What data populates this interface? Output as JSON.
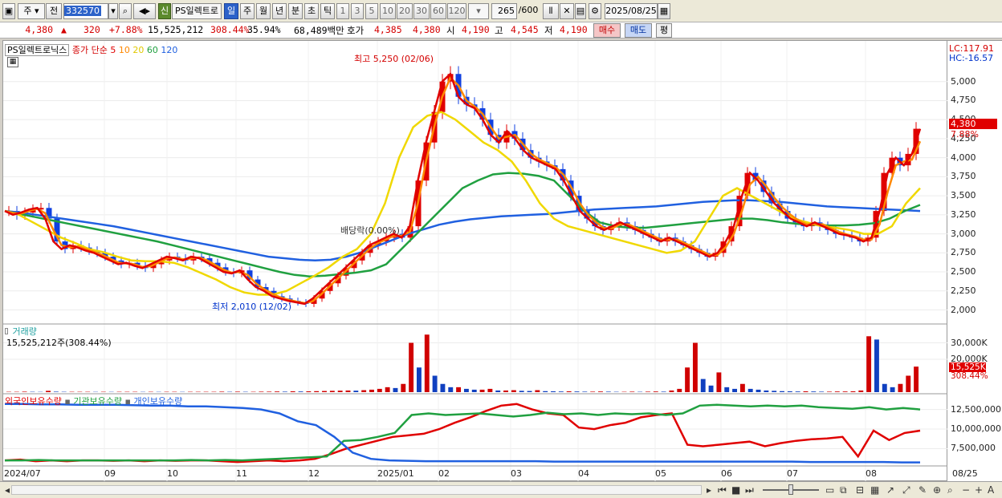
{
  "toolbar": {
    "market_type": "주",
    "prev": "전",
    "code": "332570",
    "new_badge": "신",
    "stock_name": "PS일렉트로",
    "periods": [
      "일",
      "주",
      "월",
      "년",
      "분",
      "초",
      "틱"
    ],
    "active_period": "일",
    "minutes": [
      "1",
      "3",
      "5",
      "10",
      "20",
      "30",
      "60",
      "120"
    ],
    "count": "265",
    "count_max": "/600",
    "date": "2025/08/25"
  },
  "quote": {
    "price": "4,380",
    "change_arrow": "▲",
    "change": "320",
    "change_pct": "+7.88%",
    "volume": "15,525,212",
    "volume_pct": "308.44%",
    "turnover_pct": "35.94%",
    "amount": "68,489백만",
    "bid_label": "호가",
    "bid_price": "4,385",
    "bid_price2": "4,380",
    "open_label": "시",
    "open": "4,190",
    "high_label": "고",
    "high": "4,545",
    "low_label": "저",
    "low": "4,190",
    "buy": "매수",
    "sell": "매도",
    "eval": "평"
  },
  "price_panel": {
    "stock_label": "PS일렉트로닉스",
    "ma_label": "종가 단순",
    "ma_periods": [
      "5",
      "10",
      "20",
      "60",
      "120"
    ],
    "ma_colors": [
      "#e00000",
      "#ff8800",
      "#f0d800",
      "#20a040",
      "#2060e0"
    ],
    "lc": "LC:117.91",
    "hc": "HC:-16.57",
    "high_annotation": "최고 5,250 (02/06)",
    "low_annotation": "최저 2,010 (12/02)",
    "dividend_annotation": "배당락(0.00%)",
    "current_price_tag": "4,380",
    "current_pct_tag": "7.88%"
  },
  "volume_panel": {
    "label": "거래량",
    "value": "15,525,212주(308.44%)",
    "tag": "15,525K",
    "tag_pct": "308.44%"
  },
  "holdings_panel": {
    "series": [
      "외국인보유수량",
      "기관보유수량",
      "개인보유수량"
    ],
    "colors": [
      "#e00000",
      "#20a040",
      "#2060e0"
    ]
  },
  "x_axis": [
    "2024/07",
    "09",
    "10",
    "11",
    "12",
    "2025/01",
    "02",
    "03",
    "04",
    "05",
    "06",
    "07",
    "08",
    "08/25"
  ],
  "chart_data": [
    {
      "type": "candlestick",
      "title": "PS일렉트로닉스",
      "y_ticks": [
        "5,000",
        "4,750",
        "4,500",
        "4,250",
        "4,000",
        "3,750",
        "3,500",
        "3,250",
        "3,000",
        "2,750",
        "2,500",
        "2,250",
        "2,000"
      ],
      "ylim": [
        1900,
        5450
      ],
      "closes": [
        3300,
        3250,
        3280,
        3320,
        3340,
        3200,
        2900,
        2800,
        2850,
        2820,
        2780,
        2750,
        2700,
        2650,
        2600,
        2620,
        2580,
        2550,
        2600,
        2650,
        2700,
        2680,
        2650,
        2700,
        2680,
        2620,
        2560,
        2500,
        2480,
        2520,
        2400,
        2300,
        2250,
        2180,
        2150,
        2120,
        2100,
        2080,
        2150,
        2250,
        2350,
        2450,
        2550,
        2650,
        2750,
        2850,
        2900,
        2950,
        3000,
        2950,
        3100,
        3700,
        4200,
        4600,
        5000,
        5100,
        4800,
        4700,
        4650,
        4500,
        4300,
        4200,
        4350,
        4250,
        4100,
        4000,
        3950,
        3900,
        3850,
        3700,
        3500,
        3300,
        3200,
        3100,
        3050,
        3100,
        3150,
        3100,
        3050,
        3000,
        2950,
        2900,
        2950,
        2900,
        2850,
        2800,
        2750,
        2700,
        2750,
        2900,
        3100,
        3500,
        3800,
        3700,
        3550,
        3400,
        3300,
        3200,
        3150,
        3100,
        3150,
        3100,
        3050,
        3000,
        2980,
        2950,
        2900,
        2950,
        3300,
        3800,
        4000,
        3900,
        4050,
        4380
      ],
      "ma120": [
        3300,
        3280,
        3250,
        3220,
        3190,
        3160,
        3130,
        3100,
        3060,
        3020,
        2980,
        2940,
        2900,
        2860,
        2820,
        2780,
        2740,
        2700,
        2680,
        2660,
        2650,
        2660,
        2700,
        2760,
        2840,
        2920,
        3000,
        3060,
        3120,
        3160,
        3190,
        3210,
        3230,
        3240,
        3250,
        3260,
        3280,
        3300,
        3320,
        3330,
        3340,
        3350,
        3360,
        3380,
        3400,
        3420,
        3430,
        3440,
        3440,
        3430,
        3420,
        3400,
        3380,
        3360,
        3350,
        3340,
        3330,
        3320,
        3310,
        3300
      ],
      "ma60": [
        3300,
        3260,
        3220,
        3180,
        3140,
        3100,
        3060,
        3020,
        2980,
        2940,
        2900,
        2850,
        2800,
        2750,
        2700,
        2650,
        2600,
        2550,
        2500,
        2460,
        2440,
        2450,
        2470,
        2490,
        2520,
        2600,
        2800,
        3000,
        3200,
        3400,
        3600,
        3700,
        3780,
        3800,
        3790,
        3760,
        3700,
        3500,
        3300,
        3150,
        3100,
        3080,
        3080,
        3100,
        3120,
        3140,
        3160,
        3180,
        3200,
        3200,
        3180,
        3150,
        3130,
        3120,
        3110,
        3110,
        3120,
        3140,
        3200,
        3300,
        3380
      ],
      "ma20": [
        3300,
        3250,
        3150,
        3050,
        2950,
        2880,
        2800,
        2760,
        2700,
        2650,
        2640,
        2640,
        2620,
        2560,
        2480,
        2400,
        2300,
        2230,
        2200,
        2200,
        2250,
        2350,
        2450,
        2560,
        2700,
        2800,
        3000,
        3400,
        4000,
        4400,
        4550,
        4600,
        4500,
        4350,
        4200,
        4100,
        3950,
        3700,
        3400,
        3200,
        3100,
        3050,
        3000,
        2950,
        2900,
        2850,
        2800,
        2750,
        2780,
        2900,
        3200,
        3500,
        3600,
        3500,
        3400,
        3300,
        3200,
        3150,
        3100,
        3080,
        3050,
        3000,
        3000,
        3100,
        3400,
        3600
      ]
    },
    {
      "type": "bar",
      "title": "거래량",
      "y_ticks": [
        "30,000K",
        "20,000K"
      ],
      "ylim": [
        0,
        40000
      ],
      "values": [
        200,
        200,
        300,
        200,
        150,
        800,
        300,
        200,
        200,
        200,
        200,
        150,
        200,
        150,
        200,
        200,
        200,
        150,
        200,
        150,
        200,
        200,
        150,
        200,
        200,
        200,
        200,
        300,
        200,
        300,
        200,
        200,
        300,
        300,
        400,
        300,
        500,
        400,
        500,
        600,
        700,
        800,
        900,
        1000,
        900,
        1200,
        1500,
        2000,
        3000,
        2500,
        5000,
        30000,
        15000,
        35000,
        10000,
        5000,
        3000,
        3000,
        2000,
        1500,
        1500,
        2000,
        1000,
        1000,
        1200,
        800,
        700,
        1200,
        600,
        500,
        400,
        500,
        400,
        300,
        300,
        400,
        300,
        200,
        200,
        300,
        200,
        300,
        400,
        300,
        1000,
        2000,
        15000,
        30000,
        8000,
        4000,
        12000,
        3000,
        2000,
        5000,
        2000,
        1500,
        1000,
        800,
        600,
        500,
        400,
        500,
        400,
        300,
        300,
        400,
        400,
        500,
        1000,
        34000,
        32000,
        5000,
        3000,
        5000,
        10000,
        15525
      ]
    },
    {
      "type": "line",
      "title": "보유수량",
      "y_ticks": [
        "12,500,000",
        "10,000,000",
        "7,500,000"
      ],
      "ylim": [
        5500000,
        14000000
      ],
      "series": [
        {
          "name": "외국인보유수량",
          "values": [
            6000000,
            6100000,
            5900000,
            6000000,
            5900000,
            6000000,
            6000000,
            5950000,
            6000000,
            5900000,
            6000000,
            5950000,
            6000000,
            6000000,
            5900000,
            5800000,
            5900000,
            6000000,
            5900000,
            6000000,
            6200000,
            6800000,
            7500000,
            8000000,
            8500000,
            9000000,
            9200000,
            9400000,
            10000000,
            10800000,
            11500000,
            12300000,
            13000000,
            13200000,
            12500000,
            12000000,
            11800000,
            10200000,
            10000000,
            10500000,
            10800000,
            11500000,
            11800000,
            12000000,
            8000000,
            7800000,
            8000000,
            8200000,
            8400000,
            7800000,
            8200000,
            8500000,
            8700000,
            8800000,
            9000000,
            6500000,
            9800000,
            8600000,
            9500000,
            9800000
          ]
        },
        {
          "name": "기관보유수량",
          "values": [
            6000000,
            6000000,
            6050000,
            6000000,
            6000000,
            6000000,
            6000000,
            6000000,
            6000000,
            6000000,
            6000000,
            6050000,
            6000000,
            6050000,
            6000000,
            6100000,
            6200000,
            6300000,
            6400000,
            6500000,
            8500000,
            8600000,
            9000000,
            9500000,
            11800000,
            12000000,
            11800000,
            11900000,
            12000000,
            11800000,
            11600000,
            11800000,
            12100000,
            11900000,
            12000000,
            11800000,
            12000000,
            11900000,
            12000000,
            11800000,
            12000000,
            13000000,
            13100000,
            13000000,
            12900000,
            13000000,
            12900000,
            13000000,
            12800000,
            12700000,
            12600000,
            12800000,
            12500000,
            12700000,
            12500000
          ]
        },
        {
          "name": "개인보유수량",
          "values": [
            13200000,
            13200000,
            13150000,
            13150000,
            13100000,
            13100000,
            13100000,
            13050000,
            13000000,
            13000000,
            12900000,
            12900000,
            12800000,
            12700000,
            12500000,
            12000000,
            11000000,
            10500000,
            9000000,
            7000000,
            6200000,
            6000000,
            5950000,
            5900000,
            5900000,
            5900000,
            5900000,
            5900000,
            5900000,
            5900000,
            5850000,
            5850000,
            5850000,
            5850000,
            5850000,
            5850000,
            5850000,
            5850000,
            5850000,
            5850000,
            5850000,
            5850000,
            5850000,
            5850000,
            5800000,
            5800000,
            5800000,
            5800000,
            5800000,
            5750000,
            5750000
          ]
        }
      ]
    }
  ]
}
